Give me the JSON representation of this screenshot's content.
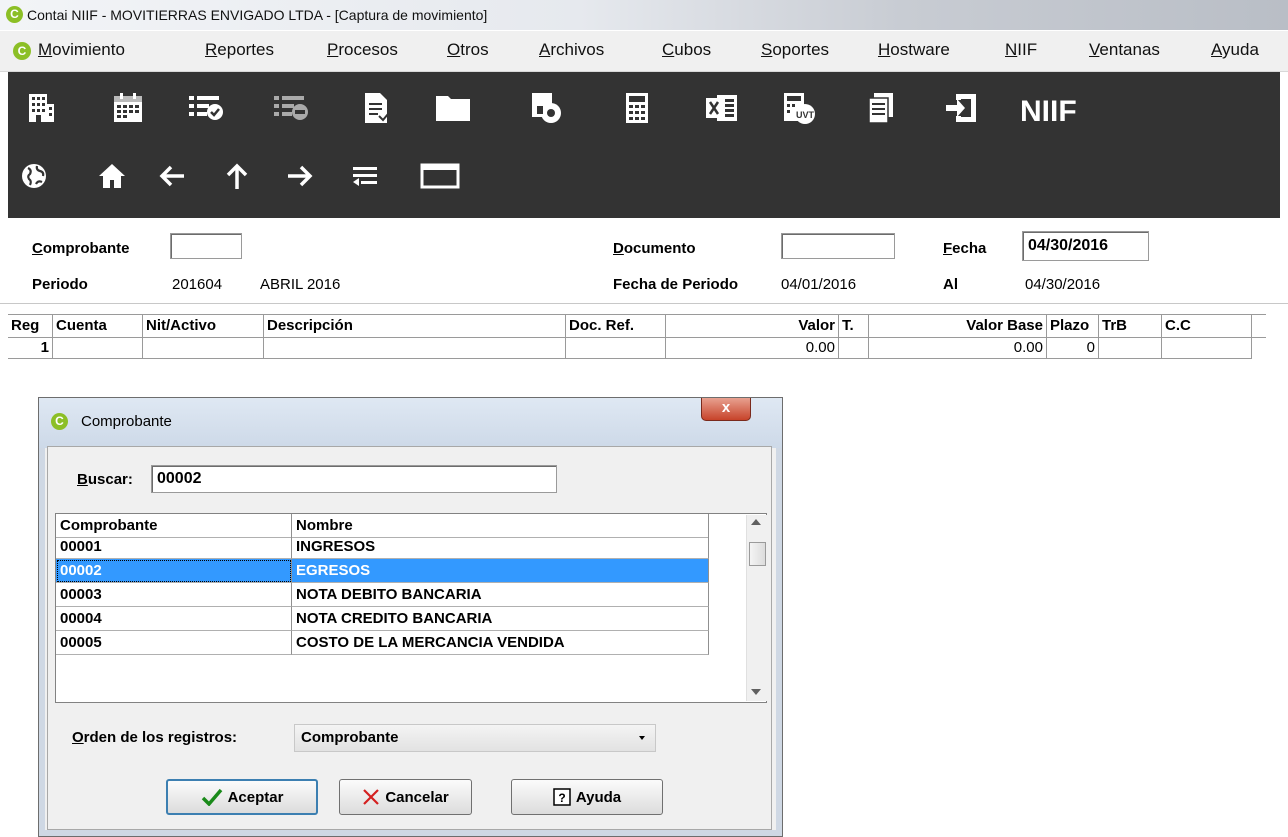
{
  "window": {
    "title": "Contai NIIF - MOVITIERRAS ENVIGADO LTDA - [Captura de movimiento]",
    "logo_letter": "C"
  },
  "menu": [
    "Movimiento",
    "Reportes",
    "Procesos",
    "Otros",
    "Archivos",
    "Cubos",
    "Soportes",
    "Hostware",
    "NIIF",
    "Ventanas",
    "Ayuda"
  ],
  "toolbar": {
    "row1_icons": [
      "company-icon",
      "calendar-icon",
      "checklist-icon",
      "niif-checklist-icon",
      "document-icon",
      "folder-icon",
      "document-settings-icon",
      "calculator-icon",
      "excel-icon",
      "uvt-calculator-icon",
      "documents-icon",
      "exit-icon"
    ],
    "niif_label": "NIIF",
    "row2_icons": [
      "globe-icon",
      "home-icon",
      "arrow-left-icon",
      "arrow-up-icon",
      "arrow-right-icon",
      "transfer-icon",
      "window-icon"
    ]
  },
  "form": {
    "comprobante_label": "Comprobante",
    "comprobante_value": "",
    "documento_label": "Documento",
    "documento_value": "",
    "fecha_label": "Fecha",
    "fecha_value": "04/30/2016",
    "periodo_label": "Periodo",
    "periodo_value": "201604",
    "periodo_name": "ABRIL 2016",
    "fecha_periodo_label": "Fecha de Periodo",
    "fecha_periodo_value": "04/01/2016",
    "al_label": "Al",
    "al_value": "04/30/2016"
  },
  "grid": {
    "columns": [
      "Reg",
      "Cuenta",
      "Nit/Activo",
      "Descripción",
      "Doc. Ref.",
      "Valor",
      "T.",
      "Valor Base",
      "Plazo",
      "TrB",
      "C.C"
    ],
    "row": {
      "reg": "1",
      "valor": "0.00",
      "valor_base": "0.00",
      "plazo": "0"
    }
  },
  "dialog": {
    "title": "Comprobante",
    "close_label": "x",
    "search_label": "Buscar:",
    "search_value": "00002",
    "list_headers": [
      "Comprobante",
      "Nombre"
    ],
    "rows": [
      {
        "code": "00001",
        "name": "INGRESOS"
      },
      {
        "code": "00002",
        "name": "EGRESOS"
      },
      {
        "code": "00003",
        "name": "NOTA DEBITO BANCARIA"
      },
      {
        "code": "00004",
        "name": "NOTA CREDITO BANCARIA"
      },
      {
        "code": "00005",
        "name": "COSTO DE LA MERCANCIA VENDIDA"
      }
    ],
    "selected_index": 1,
    "order_label": "Orden de los registros:",
    "order_value": "Comprobante",
    "accept_label": "Aceptar",
    "cancel_label": "Cancelar",
    "help_label": "Ayuda"
  }
}
